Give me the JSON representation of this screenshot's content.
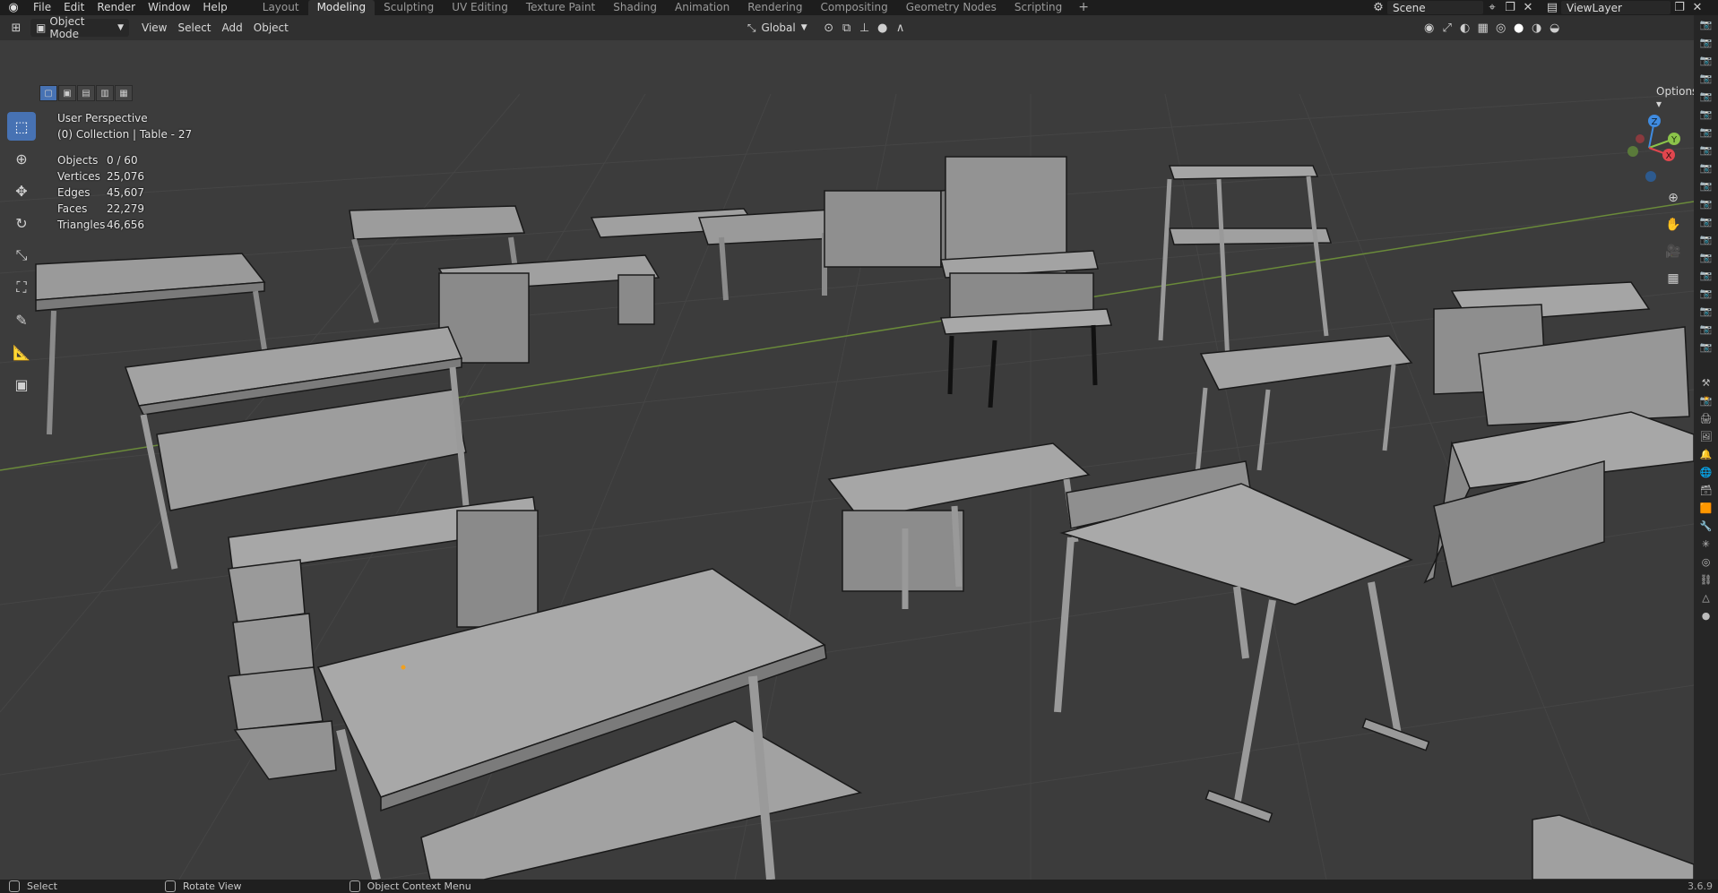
{
  "topbar": {
    "menus": [
      "File",
      "Edit",
      "Render",
      "Window",
      "Help"
    ],
    "workspaces": [
      "Layout",
      "Modeling",
      "Sculpting",
      "UV Editing",
      "Texture Paint",
      "Shading",
      "Animation",
      "Rendering",
      "Compositing",
      "Geometry Nodes",
      "Scripting"
    ],
    "active_workspace": "Modeling",
    "add_tab": "+",
    "scene": "Scene",
    "view_layer": "ViewLayer"
  },
  "header": {
    "mode": "Object Mode",
    "menus": [
      "View",
      "Select",
      "Add",
      "Object"
    ],
    "orientation": "Global",
    "options": "Options"
  },
  "viewport": {
    "perspective": "User Perspective",
    "collection": "(0) Collection | Table - 27",
    "stats": [
      {
        "label": "Objects",
        "value": "0 / 60"
      },
      {
        "label": "Vertices",
        "value": "25,076"
      },
      {
        "label": "Edges",
        "value": "45,607"
      },
      {
        "label": "Faces",
        "value": "22,279"
      },
      {
        "label": "Triangles",
        "value": "46,656"
      }
    ],
    "gizmo": {
      "x": "X",
      "y": "Y",
      "z": "Z"
    }
  },
  "statusbar": {
    "select": "Select",
    "rotate": "Rotate View",
    "context": "Object Context Menu",
    "version": "3.6.9"
  },
  "colors": {
    "accent": "#4772b3",
    "x_axis": "#e0464e",
    "y_axis": "#8bc34a",
    "z_axis": "#3f8be0"
  }
}
